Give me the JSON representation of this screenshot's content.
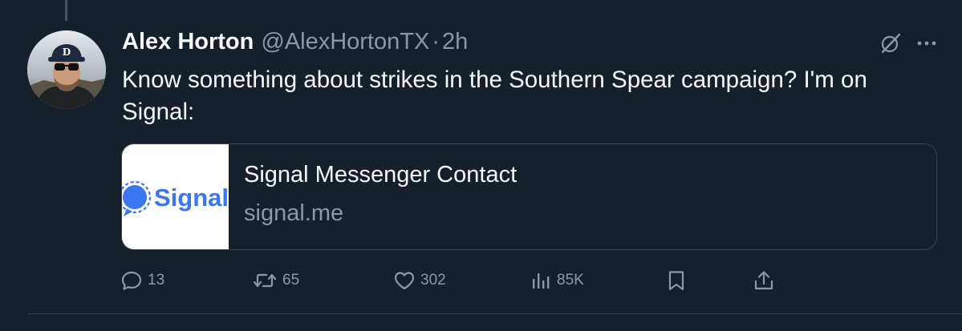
{
  "tweet": {
    "author_name": "Alex Horton",
    "handle": "@AlexHortonTX",
    "separator": "·",
    "time": "2h",
    "text": "Know something about strikes in the Southern Spear campaign? I'm on Signal:"
  },
  "card": {
    "thumbnail_logo_text": "Signal",
    "title": "Signal Messenger Contact",
    "domain": "signal.me"
  },
  "actions": {
    "replies": "13",
    "reposts": "65",
    "likes": "302",
    "views": "85K"
  },
  "colors": {
    "background": "#15202b",
    "primary_text": "#f7f9f9",
    "secondary_text": "#8b98a5",
    "border": "#38444d",
    "signal_blue": "#3a76f0"
  },
  "icons": {
    "reply": "reply-icon",
    "repost": "repost-icon",
    "like": "heart-icon",
    "views": "views-icon",
    "bookmark": "bookmark-icon",
    "share": "share-icon",
    "grok": "grok-icon",
    "more": "more-icon"
  }
}
